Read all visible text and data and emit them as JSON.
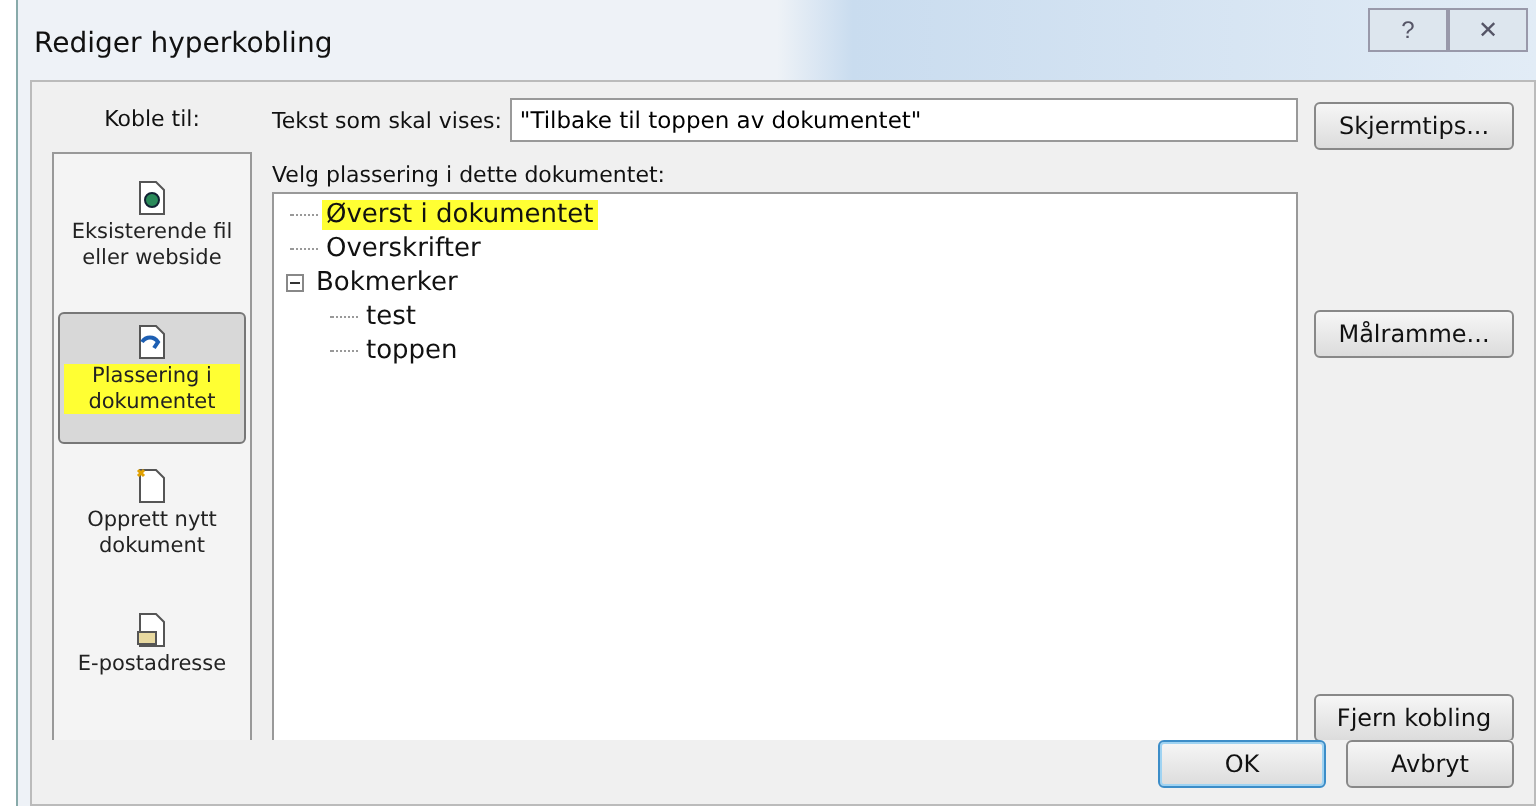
{
  "window": {
    "title": "Rediger hyperkobling",
    "controls": [
      "?",
      "✕"
    ]
  },
  "link_to": {
    "label": "Koble til:",
    "items": [
      {
        "label": "Eksisterende fil eller webside",
        "kind": "file",
        "selected": false
      },
      {
        "label": "Plassering i dokumentet",
        "kind": "place",
        "selected": true
      },
      {
        "label": "Opprett nytt dokument",
        "kind": "new",
        "selected": false
      },
      {
        "label": "E-postadresse",
        "kind": "mail",
        "selected": false
      }
    ]
  },
  "display_text": {
    "label": "Tekst som skal vises:",
    "value": "\"Tilbake til toppen av dokumentet\""
  },
  "location": {
    "label": "Velg plassering i dette dokumentet:",
    "tree": [
      {
        "label": "Øverst i dokumentet",
        "selected": true
      },
      {
        "label": "Overskrifter",
        "selected": false
      },
      {
        "label": "Bokmerker",
        "selected": false,
        "expanded": true,
        "children": [
          {
            "label": "test",
            "selected": false
          },
          {
            "label": "toppen",
            "selected": false
          }
        ]
      }
    ]
  },
  "side_buttons": [
    "Skjermtips...",
    "Målramme...",
    "Fjern kobling"
  ],
  "buttons": [
    {
      "label": "OK",
      "default": true
    },
    {
      "label": "Avbryt",
      "default": false
    }
  ]
}
